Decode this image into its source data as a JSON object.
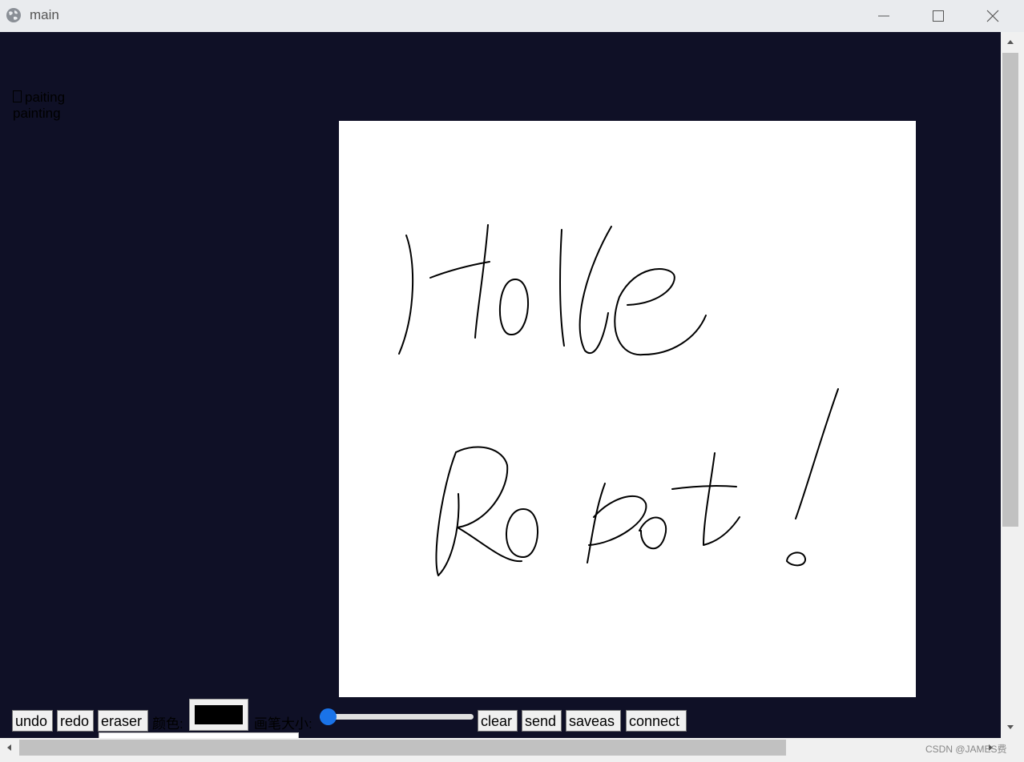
{
  "window": {
    "title": "main"
  },
  "heading": {
    "line1": "paiting",
    "line2": "painting"
  },
  "toolbar": {
    "undo": "undo",
    "redo": "redo",
    "eraser": "eraser",
    "color_label": "颜色:",
    "color_value": "#000000",
    "size_label": "画笔大小:",
    "brush_size_fraction": 0.0,
    "clear": "clear",
    "send": "send",
    "saveas": "saveas",
    "connect": "connect"
  },
  "watermark": "CSDN @JAMES费",
  "icons": [
    "globe-icon",
    "minimize-icon",
    "maximize-icon",
    "close-icon",
    "scroll-up-icon",
    "scroll-down-icon",
    "scroll-left-icon",
    "scroll-right-icon"
  ],
  "colors": {
    "background": "#0f1026",
    "canvas": "#ffffff",
    "accent": "#1a73e8"
  }
}
